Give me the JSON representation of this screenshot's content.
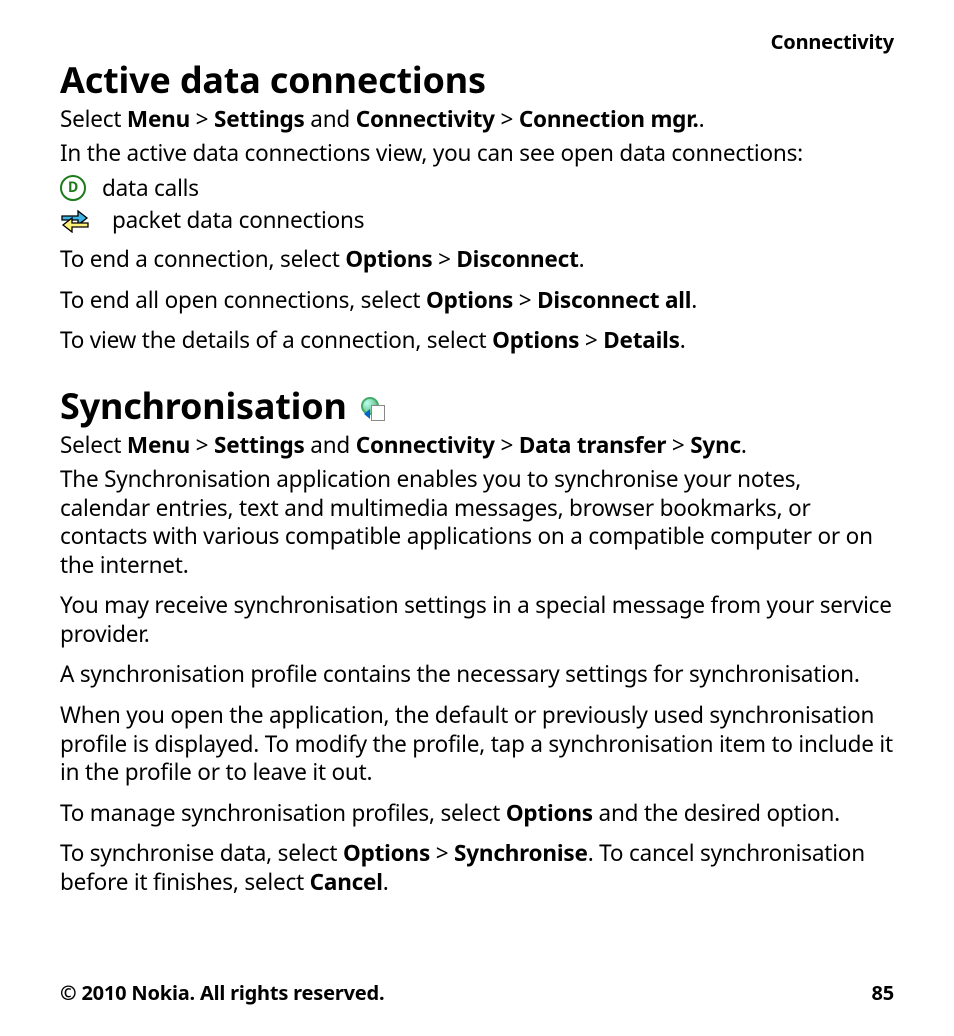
{
  "header": {
    "breadcrumb": "Connectivity"
  },
  "section1": {
    "title": "Active data connections",
    "nav": {
      "prefix": "Select ",
      "menu": "Menu",
      "gt1": "  >  ",
      "settings": "Settings",
      "and": " and ",
      "connectivity": "Connectivity",
      "gt2": "  >  ",
      "connmgr": "Connection mgr.",
      "suffix": "."
    },
    "intro": "In the active data connections view, you can see open data connections:",
    "icons": {
      "data_calls": "data calls",
      "packet": "packet data connections"
    },
    "end_one": {
      "t1": "To end a connection, select ",
      "options": "Options",
      "gt": "  >  ",
      "disconnect": "Disconnect",
      "t2": "."
    },
    "end_all": {
      "t1": "To end all open connections, select ",
      "options": "Options",
      "gt": "  >  ",
      "disconnect_all": "Disconnect all",
      "t2": "."
    },
    "details": {
      "t1": "To view the details of a connection, select ",
      "options": "Options",
      "gt": "  >  ",
      "details": "Details",
      "t2": "."
    }
  },
  "section2": {
    "title": "Synchronisation",
    "nav": {
      "prefix": "Select ",
      "menu": "Menu",
      "gt1": "  >  ",
      "settings": "Settings",
      "and": " and ",
      "connectivity": "Connectivity",
      "gt2": "  >  ",
      "data_transfer": "Data transfer",
      "gt3": "  >  ",
      "sync": "Sync",
      "suffix": "."
    },
    "para1": "The Synchronisation application enables you to synchronise your notes, calendar entries, text and multimedia messages, browser bookmarks, or contacts with various compatible applications on a compatible computer or on the internet.",
    "para2": "You may receive synchronisation settings in a special message from your service provider.",
    "para3": "A synchronisation profile contains the necessary settings for synchronisation.",
    "para4": "When you open the application, the default or previously used synchronisation profile is displayed. To modify the profile, tap a synchronisation item to include it in the profile or to leave it out.",
    "manage": {
      "t1": "To manage synchronisation profiles, select ",
      "options": "Options",
      "t2": " and the desired option."
    },
    "do_sync": {
      "t1": "To synchronise data, select ",
      "options": "Options",
      "gt": "  >  ",
      "synchronise": "Synchronise",
      "t2": ". To cancel synchronisation before it finishes, select ",
      "cancel": "Cancel",
      "t3": "."
    }
  },
  "footer": {
    "copyright": "© 2010 Nokia. All rights reserved.",
    "page_number": "85"
  }
}
